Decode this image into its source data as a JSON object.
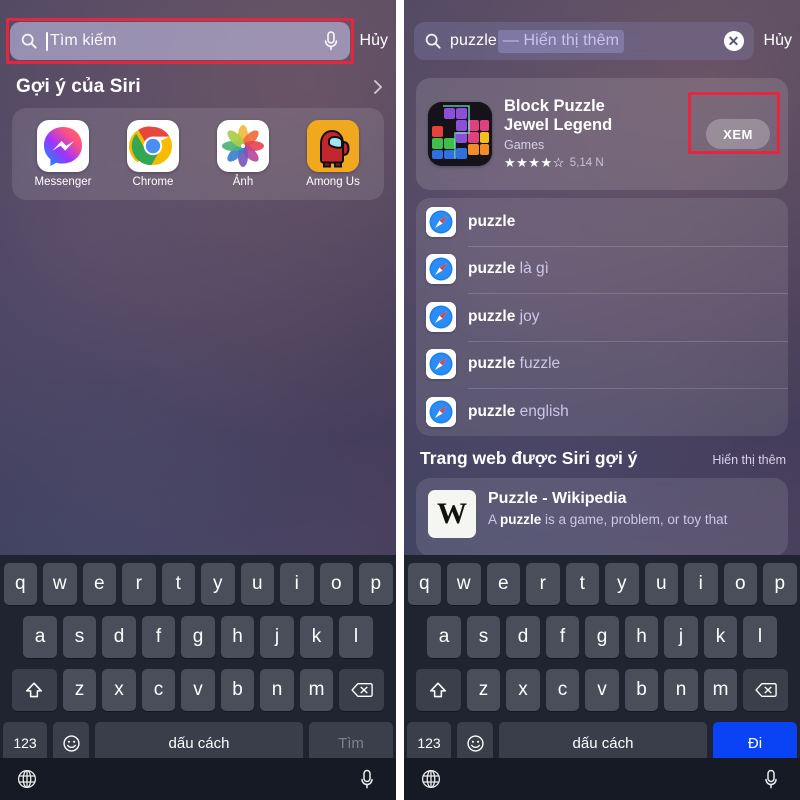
{
  "left": {
    "search": {
      "placeholder": "Tìm kiếm",
      "value": "",
      "search_icon": "search-icon",
      "mic_icon": "mic-icon",
      "cancel_label": "Hủy",
      "highlighted": true
    },
    "siri_section": {
      "title": "Gợi ý của Siri",
      "chevron_icon": "chevron-right-icon"
    },
    "apps": [
      {
        "name": "Messenger",
        "icon": "messenger-icon"
      },
      {
        "name": "Chrome",
        "icon": "chrome-icon"
      },
      {
        "name": "Ảnh",
        "icon": "photos-icon"
      },
      {
        "name": "Among Us",
        "icon": "among-us-icon"
      }
    ],
    "keyboard": {
      "row1": [
        "q",
        "w",
        "e",
        "r",
        "t",
        "y",
        "u",
        "i",
        "o",
        "p"
      ],
      "row2": [
        "a",
        "s",
        "d",
        "f",
        "g",
        "h",
        "j",
        "k",
        "l"
      ],
      "row3": [
        "z",
        "x",
        "c",
        "v",
        "b",
        "n",
        "m"
      ],
      "shift_icon": "shift-icon",
      "backspace_icon": "backspace-icon",
      "numbers_label": "123",
      "emoji_icon": "emoji-icon",
      "space_label": "dấu cách",
      "return_label": "Tìm",
      "return_state": "disabled",
      "globe_icon": "globe-icon",
      "dictation_icon": "mic-icon"
    }
  },
  "right": {
    "search": {
      "search_icon": "search-icon",
      "value": "puzzle",
      "completion": "— Hiển thị thêm",
      "clear_icon": "clear-icon",
      "cancel_label": "Hủy"
    },
    "app_result": {
      "icon": "block-puzzle-icon",
      "title_line1": "Block Puzzle",
      "title_line2": "Jewel Legend",
      "category": "Games",
      "stars": "★★★★",
      "half_star": "☆",
      "rating_count": "5,14 N",
      "action_label": "XEM",
      "action_highlighted": true
    },
    "suggestions": [
      {
        "icon": "safari-icon",
        "match": "puzzle",
        "rest": ""
      },
      {
        "icon": "safari-icon",
        "match": "puzzle",
        "rest": " là gì"
      },
      {
        "icon": "safari-icon",
        "match": "puzzle",
        "rest": " joy"
      },
      {
        "icon": "safari-icon",
        "match": "puzzle",
        "rest": " fuzzle"
      },
      {
        "icon": "safari-icon",
        "match": "puzzle",
        "rest": " english"
      }
    ],
    "web_section": {
      "title": "Trang web được Siri gợi ý",
      "more_label": "Hiển thị thêm",
      "result": {
        "icon": "wikipedia-icon",
        "icon_glyph": "W",
        "title": "Puzzle - Wikipedia",
        "snippet_prefix": "A ",
        "snippet_bold": "puzzle",
        "snippet_rest": " is a game, problem, or toy that"
      }
    },
    "keyboard": {
      "row1": [
        "q",
        "w",
        "e",
        "r",
        "t",
        "y",
        "u",
        "i",
        "o",
        "p"
      ],
      "row2": [
        "a",
        "s",
        "d",
        "f",
        "g",
        "h",
        "j",
        "k",
        "l"
      ],
      "row3": [
        "z",
        "x",
        "c",
        "v",
        "b",
        "n",
        "m"
      ],
      "shift_icon": "shift-icon",
      "backspace_icon": "backspace-icon",
      "numbers_label": "123",
      "emoji_icon": "emoji-icon",
      "space_label": "dấu cách",
      "return_label": "Đi",
      "return_state": "active",
      "globe_icon": "globe-icon",
      "dictation_icon": "mic-icon"
    }
  },
  "colors": {
    "annotation_red": "#e8253f",
    "keyboard_bg": "#1f2430",
    "key_bg": "#4a4e5a",
    "go_blue": "#0a42f5",
    "wallpaper_base": "#4a4560"
  }
}
